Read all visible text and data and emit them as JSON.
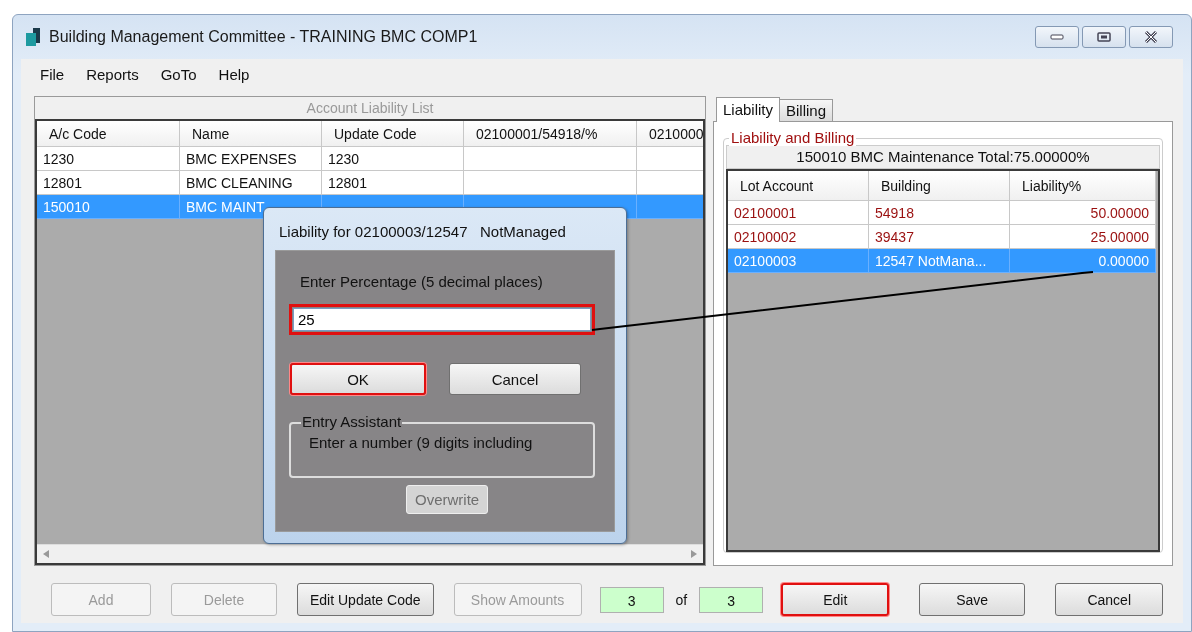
{
  "window": {
    "title": "Building Management Committee - TRAINING BMC COMP1"
  },
  "menu": [
    {
      "label": "File"
    },
    {
      "label": "Reports"
    },
    {
      "label": "GoTo"
    },
    {
      "label": "Help"
    }
  ],
  "account_list": {
    "title": "Account Liability List",
    "columns": [
      "A/c Code",
      "Name",
      "Update Code",
      "02100001/54918/%",
      "0210000"
    ],
    "rows": [
      {
        "cells": [
          "1230",
          "BMC EXPENSES",
          "1230"
        ],
        "selected": false
      },
      {
        "cells": [
          "12801",
          "BMC CLEANING",
          "12801"
        ],
        "selected": false
      },
      {
        "cells": [
          "150010",
          "BMC MAINT"
        ],
        "selected": true
      }
    ]
  },
  "tabs": [
    {
      "label": "Liability",
      "selected": true
    },
    {
      "label": "Billing",
      "selected": false
    }
  ],
  "liability_panel": {
    "group_title": "Liability and Billing",
    "summary": "150010 BMC Maintenance Total:75.00000%",
    "columns": [
      "Lot Account",
      "Building",
      "Liability%"
    ],
    "rows": [
      {
        "cells": [
          "02100001",
          "54918",
          "50.00000"
        ],
        "selected": false
      },
      {
        "cells": [
          "02100002",
          "39437",
          "25.00000"
        ],
        "selected": false
      },
      {
        "cells": [
          "02100003",
          "12547   NotMana...",
          "0.00000"
        ],
        "selected": true
      }
    ]
  },
  "dialog": {
    "title": "Liability for 02100003/12547   NotManaged",
    "prompt": "Enter Percentage (5 decimal places)",
    "input": {
      "value": "25",
      "highlighted": true
    },
    "buttons": [
      {
        "label": "OK",
        "highlighted": true,
        "disabled": false
      },
      {
        "label": "Cancel",
        "highlighted": false,
        "disabled": false
      }
    ],
    "assistant": {
      "title": "Entry Assistant",
      "text": "Enter a number (9 digits including"
    },
    "overwrite_button": {
      "label": "Overwrite",
      "disabled": true
    }
  },
  "footer": [
    {
      "kind": "button",
      "label": "Add",
      "disabled": true,
      "highlighted": false
    },
    {
      "kind": "button",
      "label": "Delete",
      "disabled": true,
      "highlighted": false
    },
    {
      "kind": "button",
      "label": "Edit Update Code",
      "disabled": false,
      "highlighted": false
    },
    {
      "kind": "button",
      "label": "Show Amounts",
      "disabled": true,
      "highlighted": false
    },
    {
      "kind": "counter",
      "current": "3",
      "of_label": "of",
      "total": "3"
    },
    {
      "kind": "button",
      "label": "Edit",
      "disabled": false,
      "highlighted": true
    },
    {
      "kind": "button",
      "label": "Save",
      "disabled": false,
      "highlighted": false
    },
    {
      "kind": "button",
      "label": "Cancel",
      "disabled": false,
      "highlighted": false
    }
  ],
  "connector": true
}
